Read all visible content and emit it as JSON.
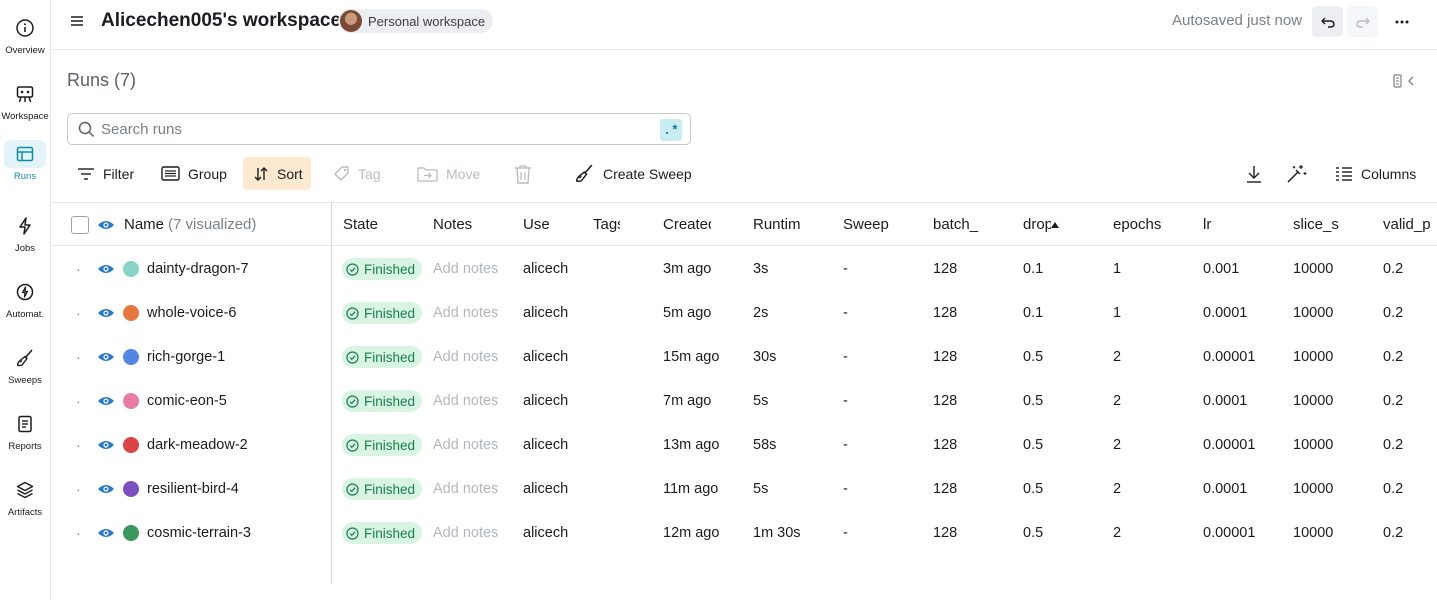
{
  "nav": [
    {
      "label": "Overview",
      "icon": "info-icon"
    },
    {
      "label": "Workspace",
      "icon": "workspace-icon"
    },
    {
      "label": "Runs",
      "icon": "table-icon",
      "active": true
    },
    {
      "label": "Jobs",
      "icon": "lightning-icon"
    },
    {
      "label": "Automat.",
      "icon": "automation-icon"
    },
    {
      "label": "Sweeps",
      "icon": "broom-icon"
    },
    {
      "label": "Reports",
      "icon": "report-icon"
    },
    {
      "label": "Artifacts",
      "icon": "layers-icon"
    }
  ],
  "header": {
    "title": "Alicechen005's workspace",
    "badge": "Personal workspace",
    "autosave": "Autosaved just now"
  },
  "runs": {
    "title": "Runs (7)",
    "search_placeholder": "Search runs",
    "regex_label": ".*"
  },
  "toolbar": {
    "filter": "Filter",
    "group": "Group",
    "sort": "Sort",
    "tag": "Tag",
    "move": "Move",
    "create_sweep": "Create Sweep",
    "columns": "Columns"
  },
  "table": {
    "name_header": "Name",
    "visualized": "(7 visualized)",
    "columns": [
      "State",
      "Notes",
      "Use",
      "Tags",
      "Created",
      "Runtim",
      "Sweep",
      "batch_",
      "drop",
      "epochs",
      "lr",
      "slice_s",
      "valid_p"
    ],
    "rows": [
      {
        "name": "dainty-dragon-7",
        "color": "#87d4c6",
        "state": "Finished",
        "notes": "Add notes",
        "user": "alicech",
        "created": "3m ago",
        "runtime": "3s",
        "sweep": "-",
        "batch": "128",
        "drop": "0.1",
        "epochs": "1",
        "lr": "0.001",
        "slice": "10000",
        "valid": "0.2"
      },
      {
        "name": "whole-voice-6",
        "color": "#e8773f",
        "state": "Finished",
        "notes": "Add notes",
        "user": "alicech",
        "created": "5m ago",
        "runtime": "2s",
        "sweep": "-",
        "batch": "128",
        "drop": "0.1",
        "epochs": "1",
        "lr": "0.0001",
        "slice": "10000",
        "valid": "0.2"
      },
      {
        "name": "rich-gorge-1",
        "color": "#5386e4",
        "state": "Finished",
        "notes": "Add notes",
        "user": "alicech",
        "created": "15m ago",
        "runtime": "30s",
        "sweep": "-",
        "batch": "128",
        "drop": "0.5",
        "epochs": "2",
        "lr": "0.00001",
        "slice": "10000",
        "valid": "0.2"
      },
      {
        "name": "comic-eon-5",
        "color": "#e87ba4",
        "state": "Finished",
        "notes": "Add notes",
        "user": "alicech",
        "created": "7m ago",
        "runtime": "5s",
        "sweep": "-",
        "batch": "128",
        "drop": "0.5",
        "epochs": "2",
        "lr": "0.0001",
        "slice": "10000",
        "valid": "0.2"
      },
      {
        "name": "dark-meadow-2",
        "color": "#db4545",
        "state": "Finished",
        "notes": "Add notes",
        "user": "alicech",
        "created": "13m ago",
        "runtime": "58s",
        "sweep": "-",
        "batch": "128",
        "drop": "0.5",
        "epochs": "2",
        "lr": "0.00001",
        "slice": "10000",
        "valid": "0.2"
      },
      {
        "name": "resilient-bird-4",
        "color": "#7c4fc0",
        "state": "Finished",
        "notes": "Add notes",
        "user": "alicech",
        "created": "11m ago",
        "runtime": "5s",
        "sweep": "-",
        "batch": "128",
        "drop": "0.5",
        "epochs": "2",
        "lr": "0.0001",
        "slice": "10000",
        "valid": "0.2"
      },
      {
        "name": "cosmic-terrain-3",
        "color": "#3a9a5c",
        "state": "Finished",
        "notes": "Add notes",
        "user": "alicech",
        "created": "12m ago",
        "runtime": "1m 30s",
        "sweep": "-",
        "batch": "128",
        "drop": "0.5",
        "epochs": "2",
        "lr": "0.00001",
        "slice": "10000",
        "valid": "0.2"
      }
    ]
  }
}
